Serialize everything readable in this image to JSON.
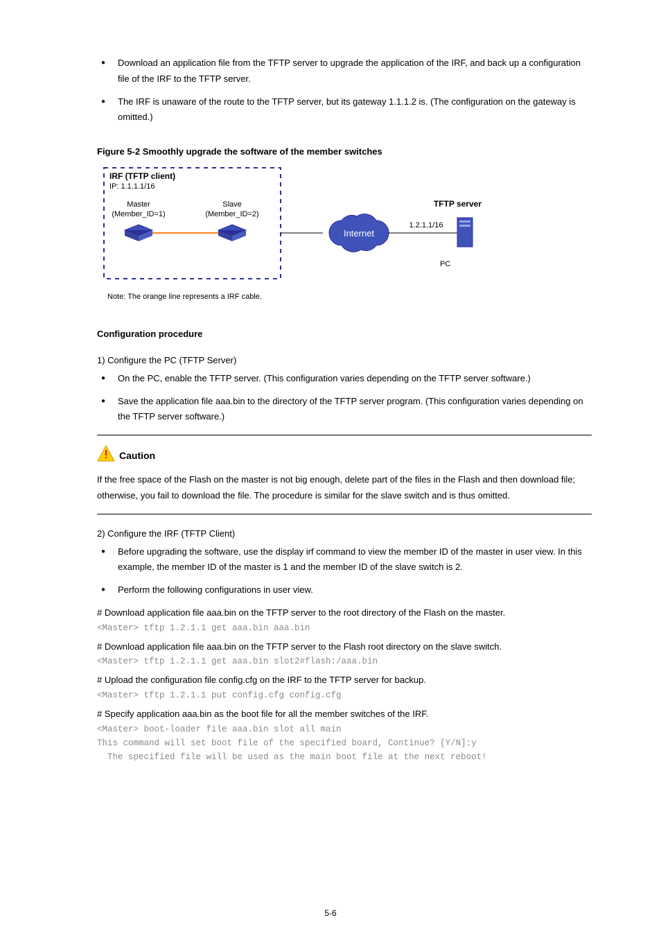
{
  "intro_bullets": [
    "Download an application file from the TFTP server to upgrade the application of the IRF, and back up a configuration file of the IRF to the TFTP server.",
    "The IRF is unaware of the route to the TFTP server, but its gateway 1.1.1.2 is. (The configuration on the gateway is omitted.)"
  ],
  "figure_caption": "Figure 5-2 Smoothly upgrade the software of the member switches",
  "diagram": {
    "note": "Note: The orange line represents a IRF cable.",
    "irf_title": "IRF (TFTP client)",
    "irf_ip": "IP: 1.1.1.1/16",
    "master_label": "Master",
    "master_member": "(Member_ID=1)",
    "slave_label": "Slave",
    "slave_member": "(Member_ID=2)",
    "internet": "Internet",
    "server_ip": "1.2.1.1/16",
    "server_title": "TFTP server",
    "server_sub": "PC"
  },
  "procedure_title": "Configuration procedure",
  "cp_step1": {
    "heading": "1)  Configure the PC (TFTP Server)",
    "items": [
      "On the PC, enable the TFTP server. (This configuration varies depending on the TFTP server software.)",
      "Save the application file aaa.bin to the directory of the TFTP server program. (This configuration varies depending on the TFTP server software.)"
    ]
  },
  "caution": {
    "word": "Caution",
    "text": "If the free space of the Flash on the master is not big enough, delete part of the files in the Flash and then download file; otherwise, you fail to download the file. The procedure is similar for the slave switch and is thus omitted."
  },
  "cp_step2": {
    "heading": "2)  Configure the IRF (TFTP Client)",
    "items": [
      "Before upgrading the software, use the display irf command to view the member ID of the master in user view. In this example, the member ID of the master is 1 and the member ID of the slave switch is 2.",
      "Perform the following configurations in user view."
    ]
  },
  "cli": {
    "comment1": "# Download application file aaa.bin on the TFTP server to the root directory of the Flash on the master.",
    "cmd1": "<Master> tftp 1.2.1.1 get aaa.bin aaa.bin",
    "comment2": "# Download application file aaa.bin on the TFTP server to the Flash root directory on the slave switch.",
    "cmd2": "<Master> tftp 1.2.1.1 get aaa.bin slot2#flash:/aaa.bin",
    "comment3": "# Upload the configuration file config.cfg on the IRF to the TFTP server for backup.",
    "cmd3": "<Master> tftp 1.2.1.1 put config.cfg config.cfg",
    "comment4": "# Specify application aaa.bin as the boot file for all the member switches of the IRF.",
    "cmd4": "<Master> boot-loader file aaa.bin slot all main",
    "out4a": "This command will set boot file of the specified board, Continue? [Y/N]:y",
    "out4b": "  The specified file will be used as the main boot file at the next reboot!"
  },
  "page_number": "5-6"
}
